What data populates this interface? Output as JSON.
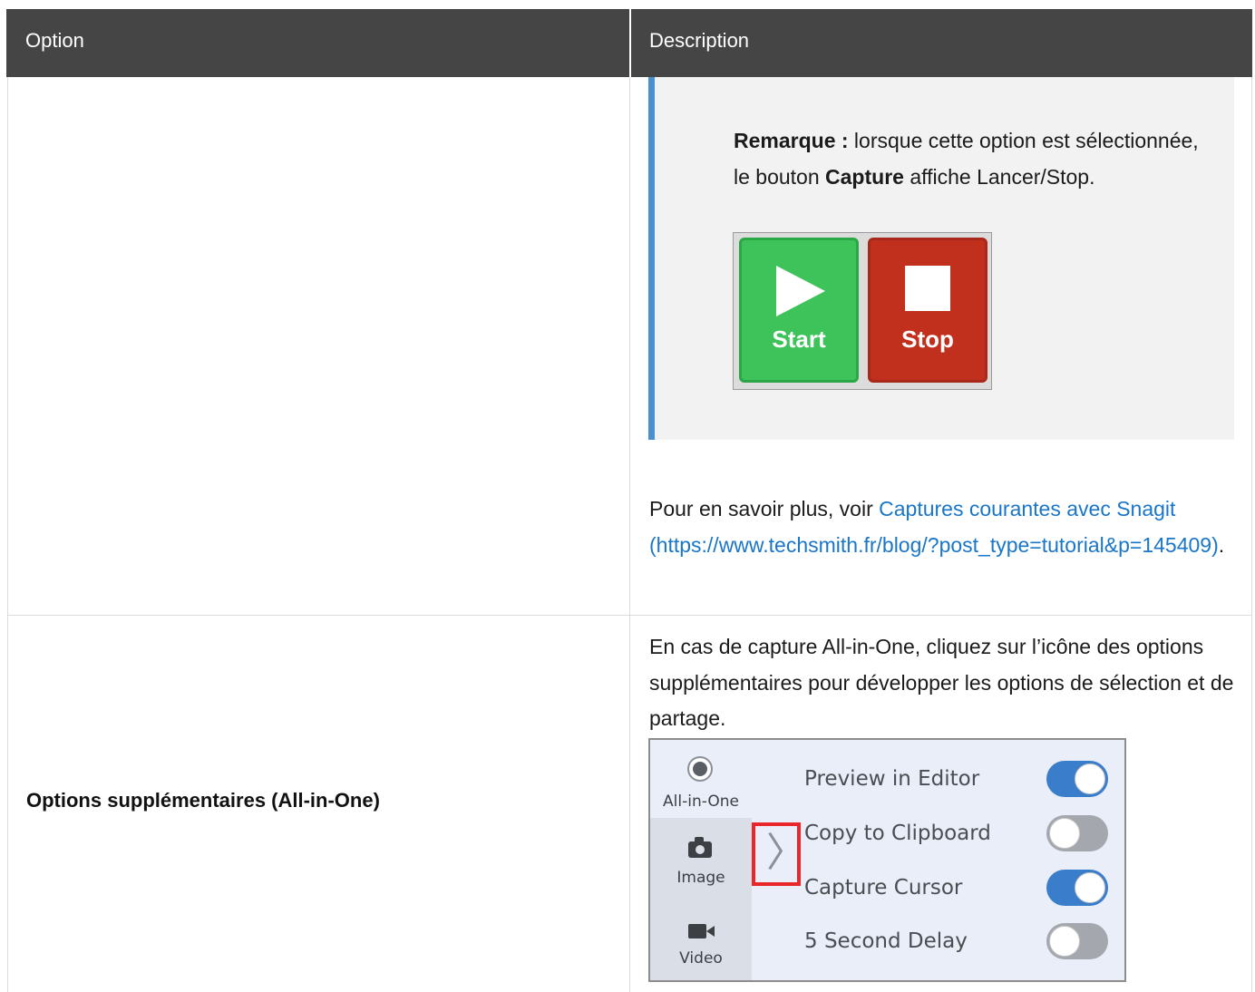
{
  "table": {
    "headers": {
      "option": "Option",
      "description": "Description"
    }
  },
  "note": {
    "bold_prefix": "Remarque :",
    "text_1": " lorsque cette option est sélectionnée, le bouton ",
    "bold_capture": "Capture",
    "text_2": " affiche Lancer/Stop."
  },
  "start_stop_image": {
    "start_label": "Start",
    "stop_label": "Stop"
  },
  "learn_more": {
    "prefix": "Pour en savoir plus, voir ",
    "link_text": "Captures courantes avec Snagit (https://www.techsmith.fr/blog/?post_type=tutorial&p=145409)",
    "suffix": "."
  },
  "row2": {
    "option_label": "Options supplémentaires (All-in-One)",
    "description": "En cas de capture All-in-One, cliquez sur l’icône des options supplémentaires pour développer les options de sélection et de partage."
  },
  "capture_panel": {
    "modes": [
      {
        "label": "All-in-One",
        "selected": true
      },
      {
        "label": "Image",
        "icon": "camera-icon"
      },
      {
        "label": "Video",
        "icon": "video-icon"
      }
    ],
    "options": [
      {
        "label": "Preview in Editor",
        "on": true
      },
      {
        "label": "Copy to Clipboard",
        "on": false
      },
      {
        "label": "Capture Cursor",
        "on": true
      },
      {
        "label": "5 Second Delay",
        "on": false
      }
    ]
  },
  "colors": {
    "header_bg": "#454545",
    "link": "#1a76c9",
    "note_border": "#4a8fd0",
    "start": "#3ec35a",
    "stop": "#c1301c",
    "highlight": "#e8262b",
    "toggle_on": "#3a7ecb"
  }
}
